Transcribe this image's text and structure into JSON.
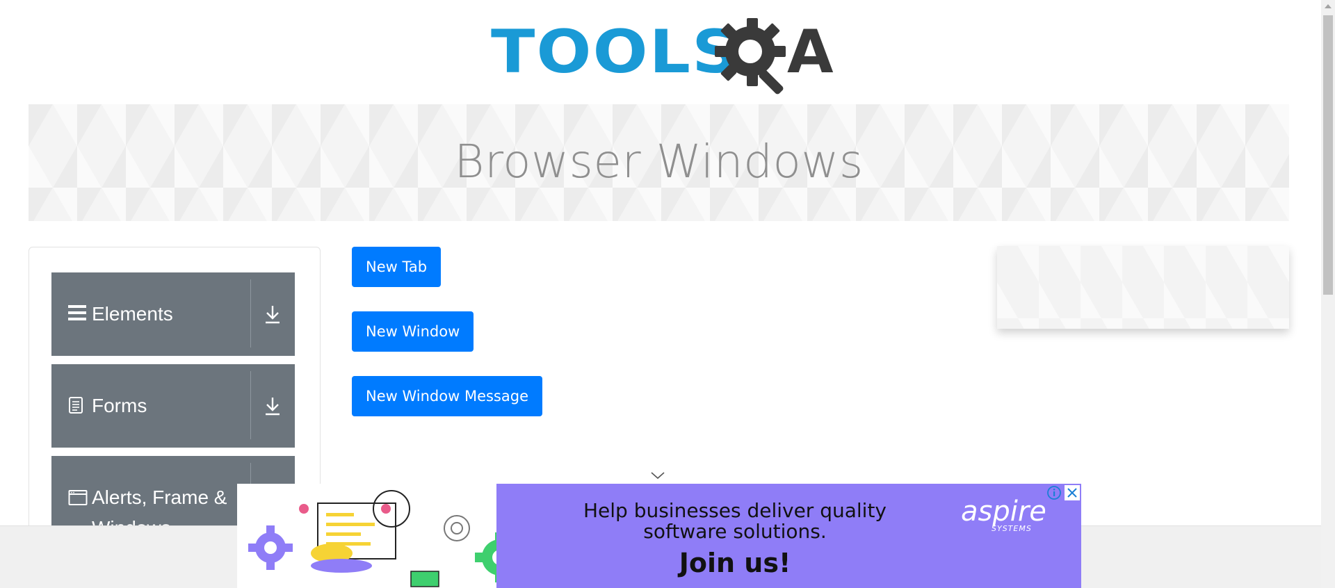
{
  "logo": {
    "text_left": "TOOLS",
    "text_right": "A"
  },
  "banner": {
    "title": "Browser Windows"
  },
  "sidebar": {
    "groups": [
      {
        "label": "Elements",
        "icon": "hamburger-icon"
      },
      {
        "label": "Forms",
        "icon": "document-icon"
      },
      {
        "label": "Alerts, Frame & Windows",
        "icon": "window-icon"
      }
    ]
  },
  "buttons": {
    "new_tab": "New Tab",
    "new_window": "New Window",
    "new_window_message": "New Window Message"
  },
  "ad": {
    "headline_line1": "Help businesses deliver quality",
    "headline_line2": "software solutions.",
    "cta": "Join us!",
    "brand": "aspire",
    "brand_sub": "SYSTEMS"
  },
  "colors": {
    "primary": "#007bff",
    "sidebar_group": "#6c757d",
    "logo_blue": "#1a9ad6",
    "logo_dark": "#3a3a3a",
    "ad_purple": "#8f7df7"
  }
}
